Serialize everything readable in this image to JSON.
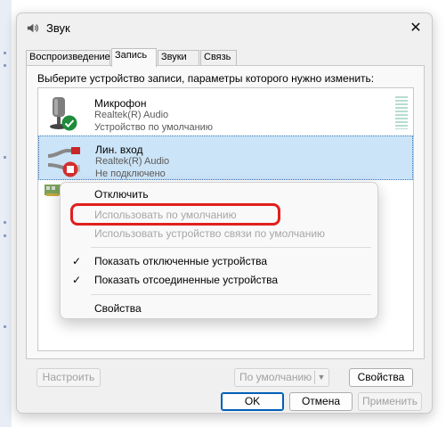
{
  "window": {
    "title": "Звук",
    "close_glyph": "✕"
  },
  "tabs": [
    {
      "label": "Воспроизведение",
      "active": false
    },
    {
      "label": "Запись",
      "active": true
    },
    {
      "label": "Звуки",
      "active": false
    },
    {
      "label": "Связь",
      "active": false
    }
  ],
  "instruction": "Выберите устройство записи, параметры которого нужно изменить:",
  "devices": [
    {
      "name": "Микрофон",
      "driver": "Realtek(R) Audio",
      "status": "Устройство по умолчанию",
      "icon": "microphone-icon",
      "badge": "default-check-icon",
      "selected": false
    },
    {
      "name": "Лин. вход",
      "driver": "Realtek(R) Audio",
      "status": "Не подключено",
      "icon": "line-in-icon",
      "badge": "disconnected-icon",
      "selected": true
    },
    {
      "name": "",
      "driver": "",
      "status": "",
      "icon": "sound-card-icon",
      "badge": "",
      "selected": false
    }
  ],
  "context_menu": {
    "items": [
      {
        "label": "Отключить",
        "checked": false,
        "disabled": false
      },
      {
        "label": "Использовать по умолчанию",
        "checked": false,
        "disabled": true
      },
      {
        "label": "Использовать устройство связи по умолчанию",
        "checked": false,
        "disabled": true
      },
      {
        "label": "Показать отключенные устройства",
        "checked": true,
        "disabled": false
      },
      {
        "label": "Показать отсоединенные устройства",
        "checked": true,
        "disabled": false
      },
      {
        "label": "Свойства",
        "checked": false,
        "disabled": false
      }
    ],
    "check_glyph": "✓"
  },
  "buttons": {
    "configure": "Настроить",
    "set_default": "По умолчанию",
    "properties": "Свойства",
    "ok": "OK",
    "cancel": "Отмена",
    "apply": "Применить"
  },
  "colors": {
    "selection": "#cce4f7",
    "highlight": "#e0201f",
    "accent": "#005fb8",
    "status_ok": "#1e8c3a",
    "status_error": "#d32f2f"
  }
}
